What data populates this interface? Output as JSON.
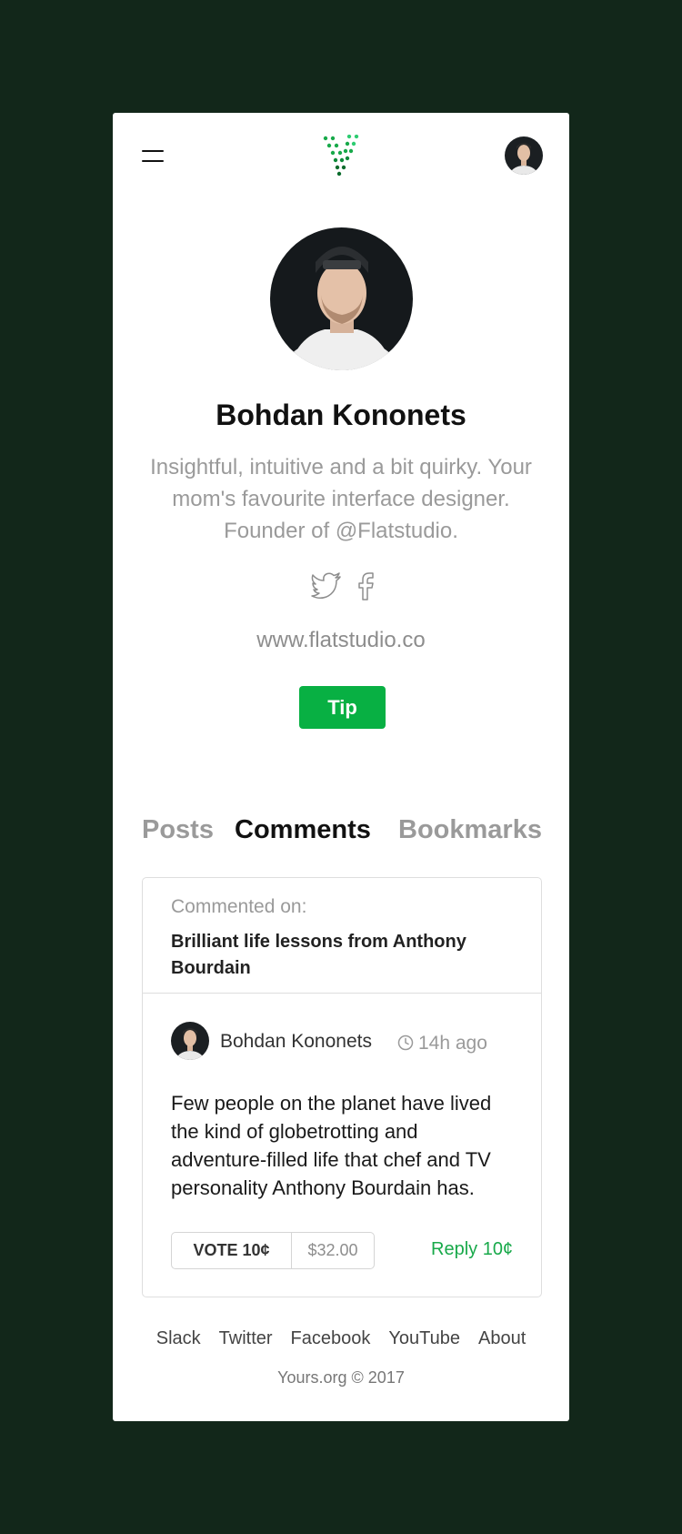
{
  "colors": {
    "background": "#12271a",
    "card": "#ffffff",
    "accent_green": "#08b043",
    "muted_text": "#9a9a9a"
  },
  "header": {
    "menu_icon": "hamburger-menu-icon",
    "logo_icon": "yours-dotted-v-logo",
    "avatar_icon": "user-avatar"
  },
  "profile": {
    "name": "Bohdan Kononets",
    "bio": "Insightful, intuitive and a bit quirky. Your mom's favourite interface designer. Founder of @Flatstudio.",
    "social_icons": [
      "twitter-icon",
      "facebook-icon"
    ],
    "website": "www.flatstudio.co",
    "tip_label": "Tip"
  },
  "tabs": [
    {
      "label": "Posts",
      "active": false
    },
    {
      "label": "Comments",
      "active": true
    },
    {
      "label": "Bookmarks",
      "active": false
    }
  ],
  "comment": {
    "commented_on_label": "Commented on:",
    "post_title": "Brilliant life lessons from Anthony Bourdain",
    "author": "Bohdan Kononets",
    "time": "14h ago",
    "text": "Few people on the planet have lived the kind of globetrotting and adventure-filled life that chef and TV personality Anthony Bourdain has.",
    "vote_label": "VOTE 10¢",
    "vote_amount": "$32.00",
    "reply_label": "Reply 10¢"
  },
  "footer": {
    "links": [
      "Slack",
      "Twitter",
      "Facebook",
      "YouTube",
      "About"
    ],
    "copyright": "Yours.org © 2017"
  }
}
